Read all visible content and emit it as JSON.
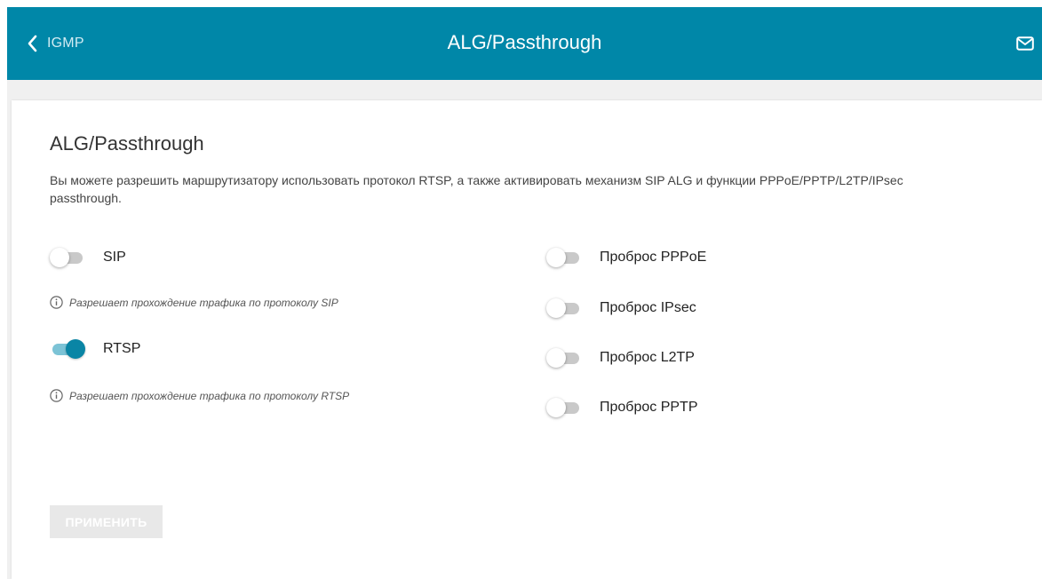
{
  "header": {
    "back_label": "IGMP",
    "title": "ALG/Passthrough",
    "icons": {
      "back": "chevron-left-icon",
      "notifications": "mail-icon"
    },
    "color": "#0087a8"
  },
  "section": {
    "title": "ALG/Passthrough",
    "description": "Вы можете разрешить маршрутизатору использовать протокол RTSP, а также активировать механизм SIP ALG и функции PPPoE/PPTP/L2TP/IPsec passthrough."
  },
  "left_toggles": [
    {
      "label": "SIP",
      "enabled": false,
      "hint": "Разрешает прохождение трафика по протоколу SIP"
    },
    {
      "label": "RTSP",
      "enabled": true,
      "hint": "Разрешает прохождение трафика по протоколу RTSP"
    }
  ],
  "right_toggles": [
    {
      "label": "Проброс PPPoE",
      "enabled": false
    },
    {
      "label": "Проброс IPsec",
      "enabled": false
    },
    {
      "label": "Проброс L2TP",
      "enabled": false
    },
    {
      "label": "Проброс PPTP",
      "enabled": false
    }
  ],
  "apply_button": {
    "label": "ПРИМЕНИТЬ",
    "disabled": true
  },
  "colors": {
    "accent": "#0087a8",
    "toggle_on_knob": "#0a85a5",
    "toggle_on_track": "#7cc3d6",
    "toggle_off_track": "#c9c9c9"
  }
}
